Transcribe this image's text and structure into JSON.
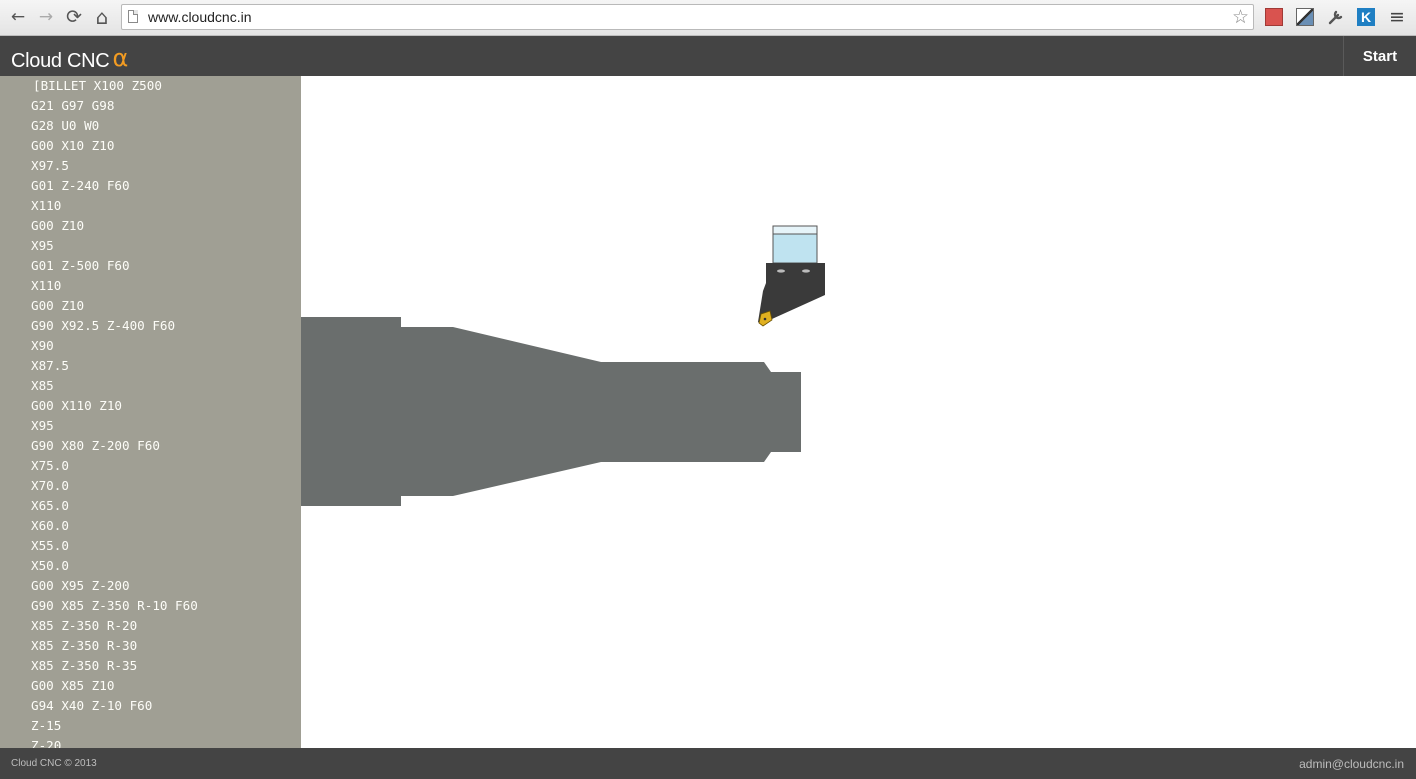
{
  "browser": {
    "url": "www.cloudcnc.in",
    "back_icon": "←",
    "forward_icon": "→",
    "reload_icon": "⟳",
    "home_icon": "⌂",
    "star_icon": "☆",
    "extension_k_label": "K",
    "menu_icon": "≡"
  },
  "app": {
    "brand": "Cloud CNC",
    "brand_alpha": "α",
    "start_label": "Start",
    "accent_color": "#f39c22"
  },
  "gcode": {
    "lines": [
      "[BILLET X100 Z500",
      "G21 G97 G98",
      "G28 U0 W0",
      "G00 X10 Z10",
      "X97.5",
      "G01 Z-240 F60",
      "X110",
      "G00 Z10",
      "X95",
      "G01 Z-500 F60",
      "X110",
      "G00 Z10",
      "G90 X92.5 Z-400 F60",
      "X90",
      "X87.5",
      "X85",
      "G00 X110 Z10",
      "X95",
      "G90 X80 Z-200 F60",
      "X75.0",
      "X70.0",
      "X65.0",
      "X60.0",
      "X55.0",
      "X50.0",
      "G00 X95 Z-200",
      "G90 X85 Z-350 R-10 F60",
      "X85 Z-350 R-20",
      "X85 Z-350 R-30",
      "X85 Z-350 R-35",
      "G00 X85 Z10",
      "G94 X40 Z-10 F60",
      "Z-15",
      "Z-20"
    ]
  },
  "footer": {
    "copyright": "Cloud CNC © 2013",
    "email": "admin@cloudcnc.in"
  },
  "colors": {
    "workpiece": "#6a6e6d",
    "sidebar_bg": "#a09f94",
    "bar_bg": "#444444",
    "insert": "#e0b020"
  }
}
